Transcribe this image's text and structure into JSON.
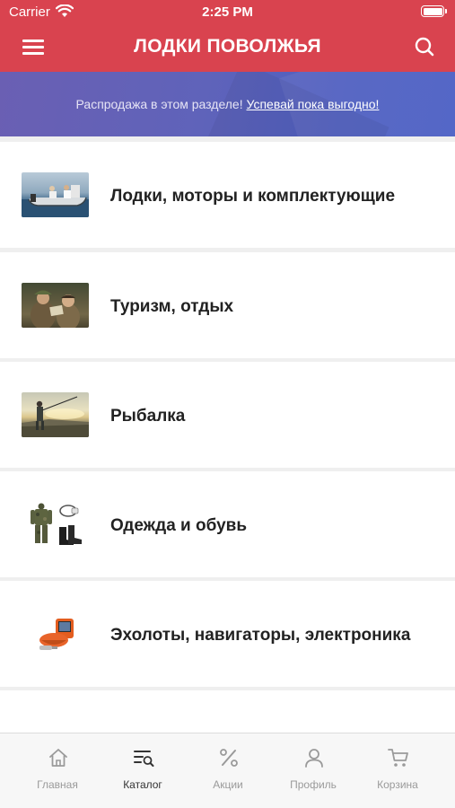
{
  "status_bar": {
    "carrier": "Carrier",
    "time": "2:25 PM"
  },
  "header": {
    "title": "ЛОДКИ ПОВОЛЖЬЯ",
    "color": "#d9434f"
  },
  "promo": {
    "text": "Распродажа в этом разделе! ",
    "link": "Успевай пока выгодно!"
  },
  "categories": [
    {
      "label": "Лодки, моторы и комплектующие",
      "icon": "boat-photo"
    },
    {
      "label": "Туризм, отдых",
      "icon": "tourism-photo"
    },
    {
      "label": "Рыбалка",
      "icon": "fishing-photo"
    },
    {
      "label": "Одежда и обувь",
      "icon": "clothing-photo"
    },
    {
      "label": "Эхолоты, навигаторы, электроника",
      "icon": "sonar-photo"
    }
  ],
  "tabs": [
    {
      "label": "Главная",
      "icon": "home-icon",
      "active": false
    },
    {
      "label": "Каталог",
      "icon": "catalog-icon",
      "active": true
    },
    {
      "label": "Акции",
      "icon": "percent-icon",
      "active": false
    },
    {
      "label": "Профиль",
      "icon": "profile-icon",
      "active": false
    },
    {
      "label": "Корзина",
      "icon": "cart-icon",
      "active": false
    }
  ]
}
